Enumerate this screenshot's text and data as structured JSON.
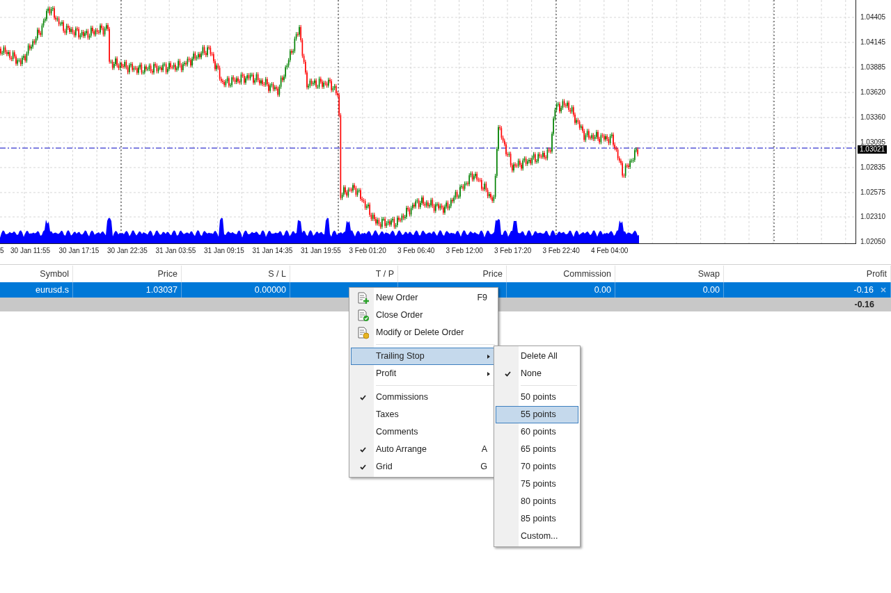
{
  "chart": {
    "price_labels": [
      "1.04405",
      "1.04145",
      "1.03885",
      "1.03620",
      "1.03360",
      "1.03095",
      "1.02835",
      "1.02575",
      "1.02310",
      "1.02050"
    ],
    "current_price": "1.03021",
    "time_labels": [
      "5",
      "30 Jan 11:55",
      "30 Jan 17:15",
      "30 Jan 22:35",
      "31 Jan 03:55",
      "31 Jan 09:15",
      "31 Jan 14:35",
      "31 Jan 19:55",
      "3 Feb 01:20",
      "3 Feb 06:40",
      "3 Feb 12:00",
      "3 Feb 17:20",
      "3 Feb 22:40",
      "4 Feb 04:00"
    ]
  },
  "table": {
    "columns": [
      "Symbol",
      "Price",
      "S / L",
      "T / P",
      "Price",
      "Commission",
      "Swap",
      "Profit"
    ],
    "rows": [
      {
        "selected": true,
        "cells": [
          "eurusd.s",
          "1.03037",
          "0.00000",
          null,
          null,
          "0.00",
          "0.00",
          "-0.16"
        ]
      }
    ],
    "total": "-0.16"
  },
  "context_menu": {
    "items": [
      {
        "kind": "item",
        "label": "New Order",
        "shortcut": "F9",
        "checked": false,
        "selected": false
      },
      {
        "kind": "item",
        "label": "Close Order",
        "checked": false,
        "selected": false
      },
      {
        "kind": "item",
        "label": "Modify or Delete Order",
        "checked": false,
        "selected": false
      },
      {
        "kind": "separator"
      },
      {
        "kind": "submenu",
        "label": "Trailing Stop",
        "checked": false,
        "selected": true
      },
      {
        "kind": "submenu",
        "label": "Profit",
        "checked": false,
        "selected": false
      },
      {
        "kind": "separator"
      },
      {
        "kind": "item",
        "label": "Commissions",
        "checked": true,
        "selected": false
      },
      {
        "kind": "item",
        "label": "Taxes",
        "checked": false,
        "selected": false
      },
      {
        "kind": "item",
        "label": "Comments",
        "checked": false,
        "selected": false
      },
      {
        "kind": "item",
        "label": "Auto Arrange",
        "shortcut": "A",
        "checked": true,
        "selected": false
      },
      {
        "kind": "item",
        "label": "Grid",
        "shortcut": "G",
        "checked": true,
        "selected": false
      }
    ]
  },
  "submenu": {
    "items": [
      {
        "kind": "item",
        "label": "Delete All",
        "checked": false,
        "selected": false
      },
      {
        "kind": "item",
        "label": "None",
        "checked": true,
        "selected": false
      },
      {
        "kind": "separator"
      },
      {
        "kind": "item",
        "label": "50 points",
        "checked": false,
        "selected": false
      },
      {
        "kind": "item",
        "label": "55 points",
        "checked": false,
        "selected": true
      },
      {
        "kind": "item",
        "label": "60 points",
        "checked": false,
        "selected": false
      },
      {
        "kind": "item",
        "label": "65 points",
        "checked": false,
        "selected": false
      },
      {
        "kind": "item",
        "label": "70 points",
        "checked": false,
        "selected": false
      },
      {
        "kind": "item",
        "label": "75 points",
        "checked": false,
        "selected": false
      },
      {
        "kind": "item",
        "label": "80 points",
        "checked": false,
        "selected": false
      },
      {
        "kind": "item",
        "label": "85 points",
        "checked": false,
        "selected": false
      },
      {
        "kind": "item",
        "label": "Custom...",
        "checked": false,
        "selected": false
      }
    ]
  }
}
